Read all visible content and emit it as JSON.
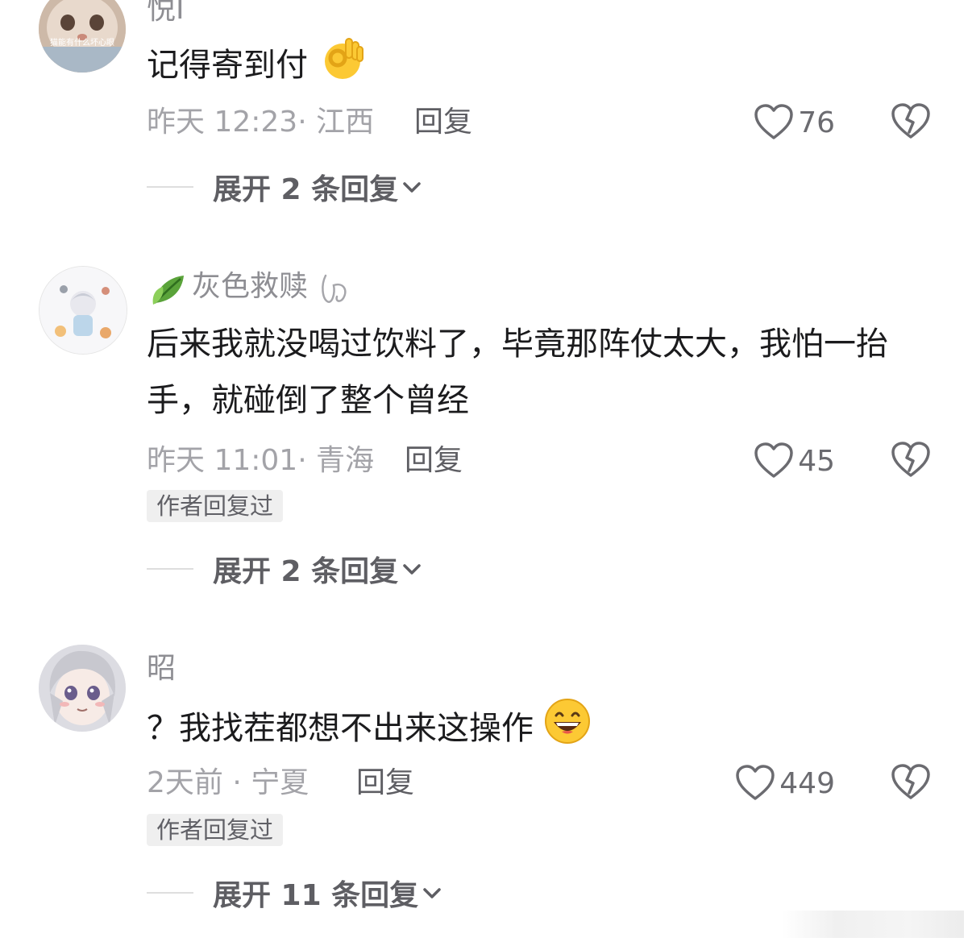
{
  "comments": [
    {
      "username": "悦I",
      "avatar_text": "猫能有什么坏心眼",
      "content": "记得寄到付",
      "emoji": "ok-hand-emoji",
      "time": "昨天 12:23",
      "location": "江西",
      "reply_label": "回复",
      "likes": "76",
      "expand_label": "展开 2 条回复"
    },
    {
      "username": "灰色救赎",
      "content": "后来我就没喝过饮料了，毕竟那阵仗太大，我怕一抬手，就碰倒了整个曾经",
      "time": "昨天 11:01",
      "location": "青海",
      "reply_label": "回复",
      "likes": "45",
      "badge": "作者回复过",
      "expand_label": "展开 2 条回复"
    },
    {
      "username": "昭",
      "content": "？我找茬都想不出来这操作",
      "emoji": "grinning-emoji",
      "time": "2天前",
      "location": "宁夏",
      "reply_label": "回复",
      "likes": "449",
      "badge": "作者回复过",
      "expand_label": "展开 11 条回复"
    }
  ],
  "colors": {
    "text_primary": "#1b1b1d",
    "text_secondary": "#a3a3a8",
    "icon": "#6b6b70",
    "badge_bg": "#efefef"
  }
}
